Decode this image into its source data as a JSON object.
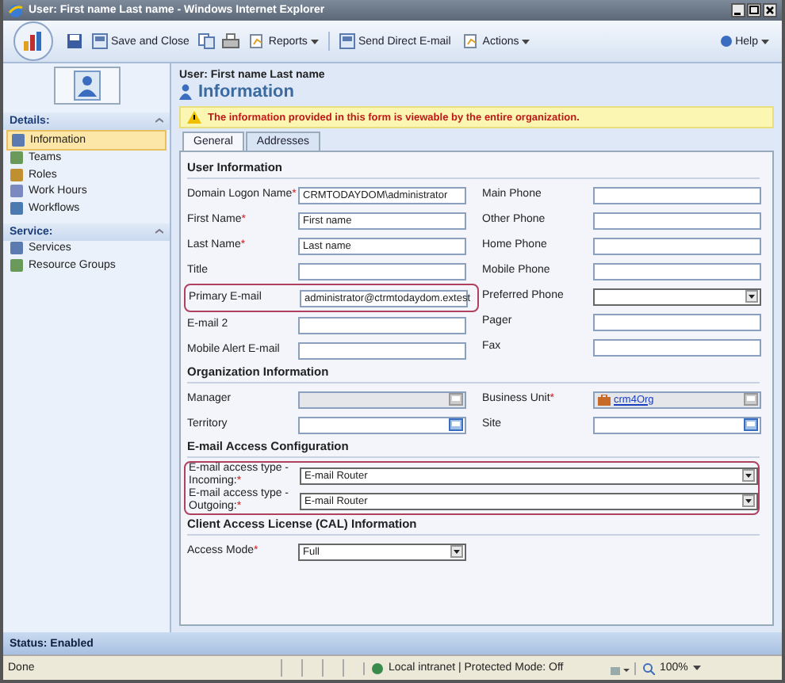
{
  "window": {
    "title": "User: First name Last name - Windows Internet Explorer"
  },
  "toolbar": [
    {
      "kind": "save"
    },
    {
      "kind": "button",
      "label": "Save and Close"
    },
    {
      "kind": "copy"
    },
    {
      "kind": "print"
    },
    {
      "kind": "menu",
      "label": "Reports"
    },
    {
      "kind": "separator"
    },
    {
      "kind": "button",
      "label": "Send Direct E-mail"
    },
    {
      "kind": "menu",
      "label": "Actions"
    }
  ],
  "help": {
    "label": "Help"
  },
  "sidebar": {
    "sections": [
      {
        "title": "Details:",
        "items": [
          {
            "label": "Information",
            "selected": true
          },
          {
            "label": "Teams",
            "selected": false
          },
          {
            "label": "Roles",
            "selected": false
          },
          {
            "label": "Work Hours",
            "selected": false
          },
          {
            "label": "Workflows",
            "selected": false
          }
        ]
      },
      {
        "title": "Service:",
        "items": [
          {
            "label": "Services",
            "selected": false
          },
          {
            "label": "Resource Groups",
            "selected": false
          }
        ]
      }
    ]
  },
  "header": {
    "entity": "User: First name Last name",
    "title": "Information"
  },
  "warning": "The information provided in this form is viewable by the entire organization.",
  "tabs": [
    {
      "label": "General",
      "selected": true
    },
    {
      "label": "Addresses",
      "selected": false
    }
  ],
  "required_mark": "*",
  "sections": [
    {
      "title": "User Information",
      "columns": [
        [
          {
            "label": "Domain Logon Name",
            "required": true,
            "kind": "text",
            "value": "CRMTODAYDOM\\administrator"
          },
          {
            "label": "First Name",
            "required": true,
            "kind": "text",
            "value": "First name"
          },
          {
            "label": "Last Name",
            "required": true,
            "kind": "text",
            "value": "Last name"
          },
          {
            "label": "Title",
            "required": false,
            "kind": "text"
          },
          {
            "label": "Primary E-mail",
            "required": false,
            "kind": "text",
            "value": "administrator@ctrmtodaydom.extest",
            "highlighted": true
          },
          {
            "label": "E-mail 2",
            "required": false,
            "kind": "text"
          },
          {
            "label": "Mobile Alert E-mail",
            "required": false,
            "kind": "text"
          }
        ],
        [
          {
            "label": "Main Phone",
            "required": false,
            "kind": "text"
          },
          {
            "label": "Other Phone",
            "required": false,
            "kind": "text"
          },
          {
            "label": "Home Phone",
            "required": false,
            "kind": "text"
          },
          {
            "label": "Mobile Phone",
            "required": false,
            "kind": "text"
          },
          {
            "label": "Preferred Phone",
            "required": false,
            "kind": "select"
          },
          {
            "label": "Pager",
            "required": false,
            "kind": "text"
          },
          {
            "label": "Fax",
            "required": false,
            "kind": "text"
          }
        ]
      ]
    },
    {
      "title": "Organization Information",
      "columns": [
        [
          {
            "label": "Manager",
            "required": false,
            "kind": "lookup",
            "disabled": true
          },
          {
            "label": "Territory",
            "required": false,
            "kind": "lookup",
            "disabled": false
          }
        ],
        [
          {
            "label": "Business Unit",
            "required": true,
            "kind": "lookup",
            "disabled": true,
            "link": "crm4Org"
          },
          {
            "label": "Site",
            "required": false,
            "kind": "lookup",
            "disabled": false
          }
        ]
      ]
    },
    {
      "title": "E-mail Access Configuration",
      "highlighted": true,
      "columns": [
        [
          {
            "label": "E-mail access type - Incoming:",
            "required": true,
            "kind": "select",
            "value": "E-mail Router"
          },
          {
            "label": "E-mail access type - Outgoing:",
            "required": true,
            "kind": "select",
            "value": "E-mail Router"
          }
        ]
      ]
    },
    {
      "title": "Client Access License (CAL) Information",
      "columns": [
        [
          {
            "label": "Access Mode",
            "required": true,
            "kind": "select",
            "value": "Full"
          }
        ]
      ]
    }
  ],
  "status": "Status: Enabled",
  "ie_status": {
    "text": "Done",
    "zone": "Local intranet | Protected Mode: Off",
    "zoom": "100%"
  }
}
